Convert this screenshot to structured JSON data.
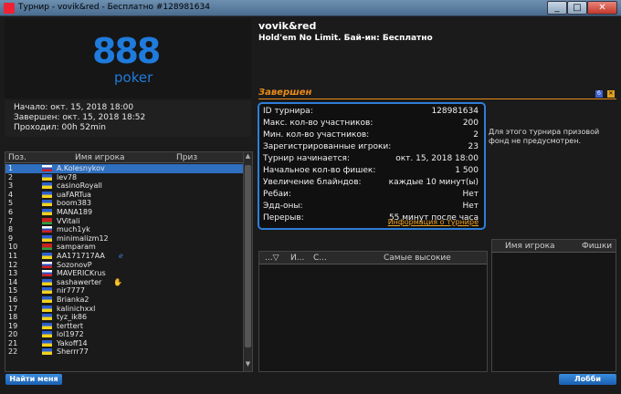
{
  "window": {
    "title": "Турнир - vovik&red - Бесплатно #128981634",
    "minimize": "_",
    "maximize": "□",
    "close": "✕"
  },
  "logo": {
    "brand": "888",
    "sub": "poker"
  },
  "info": {
    "start": "Начало: окт. 15, 2018 18:00",
    "end": "Завершен: окт. 15, 2018 18:52",
    "elapsed": "Проходил: 00h 52min"
  },
  "players": {
    "columns": [
      "Поз.",
      "Имя игрока",
      "Приз"
    ],
    "rows": [
      {
        "pos": "1",
        "name": "A.Kolesnykov",
        "flag": "ru"
      },
      {
        "pos": "2",
        "name": "lev78",
        "flag": "ua"
      },
      {
        "pos": "3",
        "name": "casinoRoyall",
        "flag": "ua"
      },
      {
        "pos": "4",
        "name": "uaFARTua",
        "flag": "ua"
      },
      {
        "pos": "5",
        "name": "boom383",
        "flag": "ua"
      },
      {
        "pos": "6",
        "name": "MANA189",
        "flag": "ua"
      },
      {
        "pos": "7",
        "name": "VVitali",
        "flag": "by"
      },
      {
        "pos": "8",
        "name": "much1yk",
        "flag": "ru"
      },
      {
        "pos": "9",
        "name": "minimalizm12",
        "flag": "ua"
      },
      {
        "pos": "10",
        "name": "samparam",
        "flag": "by"
      },
      {
        "pos": "11",
        "name": "AA171717AA",
        "flag": "ua",
        "icon": "ie-icon"
      },
      {
        "pos": "12",
        "name": "SozonovP",
        "flag": "ru"
      },
      {
        "pos": "13",
        "name": "MAVERICKrus",
        "flag": "ru"
      },
      {
        "pos": "14",
        "name": "sashawerter",
        "flag": "ua",
        "icon": "cursor-icon"
      },
      {
        "pos": "15",
        "name": "nir7777",
        "flag": "ua"
      },
      {
        "pos": "16",
        "name": "Brianka2",
        "flag": "ua"
      },
      {
        "pos": "17",
        "name": "kalinichxxl",
        "flag": "ua"
      },
      {
        "pos": "18",
        "name": "tyz_ik86",
        "flag": "ua"
      },
      {
        "pos": "19",
        "name": "terttert",
        "flag": "ua"
      },
      {
        "pos": "20",
        "name": "lol1972",
        "flag": "ua"
      },
      {
        "pos": "21",
        "name": "Yakoff14",
        "flag": "ua"
      },
      {
        "pos": "22",
        "name": "Sherrr77",
        "flag": "ua"
      }
    ]
  },
  "header": {
    "player": "vovik&red",
    "game": "Hold'em No Limit. Бай-ин: Бесплатно",
    "status": "Завершен"
  },
  "tournament": {
    "rows": [
      {
        "label": "ID турнира:",
        "value": "128981634"
      },
      {
        "label": "Макс. кол-во участников:",
        "value": "200"
      },
      {
        "label": "Мин. кол-во участников:",
        "value": "2"
      },
      {
        "label": "Зарегистрированные игроки:",
        "value": "23"
      },
      {
        "label": "Турнир начинается:",
        "value": "окт. 15, 2018 18:00"
      },
      {
        "label": "Начальное кол-во фишек:",
        "value": "1 500"
      },
      {
        "label": "Увеличение блайндов:",
        "value": "каждые 10 минут(ы)"
      },
      {
        "label": "Ребаи:",
        "value": "Нет"
      },
      {
        "label": "Эдд-оны:",
        "value": "Нет"
      },
      {
        "label": "Перерыв:",
        "value": "55 минут после часа"
      }
    ],
    "link": "Информация о турнире"
  },
  "prize_note": "Для этого турнира призовой фонд не предусмотрен.",
  "hands_table": {
    "columns": [
      "...▽",
      "И...",
      "С...",
      "Самые высокие"
    ]
  },
  "chips_table": {
    "columns": [
      "Имя игрока",
      "Фишки"
    ]
  },
  "buttons": {
    "find_me": "Найти меня",
    "lobby": "Лобби"
  },
  "status_icons": {
    "left": "б",
    "right": "✕"
  },
  "colors": {
    "accent": "#2f7ed8",
    "status": "#e88a1a",
    "selected": "#2f6fc0"
  }
}
